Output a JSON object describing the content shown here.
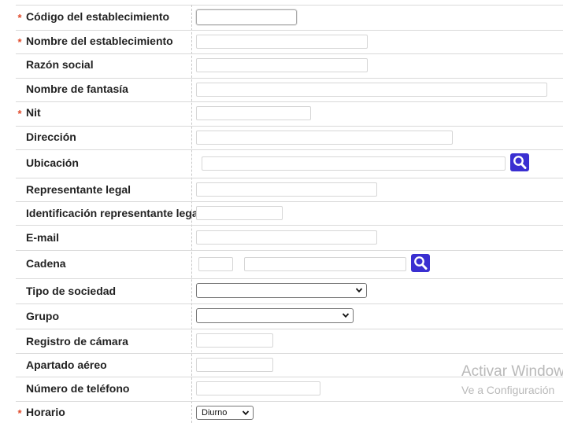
{
  "required_mark": "*",
  "form": {
    "codigo": {
      "label": "Código del establecimiento",
      "value": ""
    },
    "nombre": {
      "label": "Nombre del establecimiento",
      "value": ""
    },
    "razon_social": {
      "label": "Razón social",
      "value": ""
    },
    "fantasia": {
      "label": "Nombre de fantasía",
      "value": ""
    },
    "nit": {
      "label": "Nit",
      "value": ""
    },
    "direccion": {
      "label": "Dirección",
      "value": ""
    },
    "ubicacion": {
      "label": "Ubicación",
      "value": ""
    },
    "representante": {
      "label": "Representante legal",
      "value": ""
    },
    "identificacion": {
      "label": "Identificación representante legal",
      "value": ""
    },
    "email": {
      "label": "E-mail",
      "value": ""
    },
    "cadena": {
      "label": "Cadena",
      "code_value": "",
      "name_value": ""
    },
    "tipo_sociedad": {
      "label": "Tipo de sociedad",
      "selected": ""
    },
    "grupo": {
      "label": "Grupo",
      "selected": ""
    },
    "registro_camara": {
      "label": "Registro de cámara",
      "value": ""
    },
    "apartado": {
      "label": "Apartado aéreo",
      "value": ""
    },
    "telefono": {
      "label": "Número de teléfono",
      "value": ""
    },
    "horario": {
      "label": "Horario",
      "selected": "Diurno"
    }
  },
  "icons": {
    "search": "search-icon",
    "dropdown": "chevron-down-icon"
  },
  "colors": {
    "accent": "#3a2fd1",
    "required": "#e04a2a"
  },
  "watermark": {
    "line1": "Activar Windows",
    "line2": "Ve a Configuración"
  }
}
